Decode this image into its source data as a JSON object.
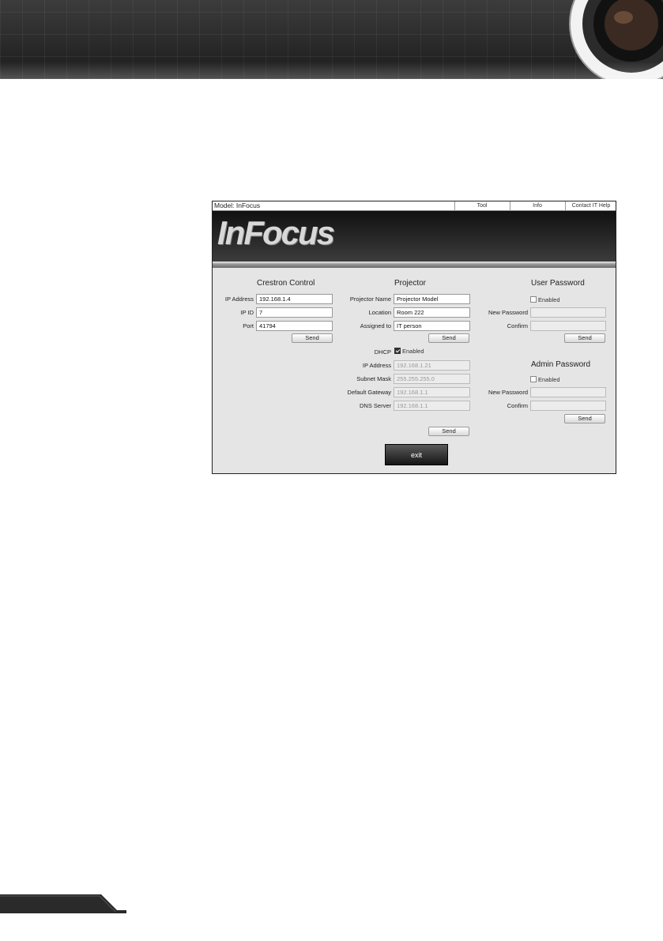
{
  "topbar": {
    "model_label": "Model: InFocus",
    "nav": [
      "Tool",
      "Info",
      "Contact IT Help"
    ]
  },
  "logo": {
    "text": "InFocus"
  },
  "crestron": {
    "title": "Crestron Control",
    "ip_label": "IP Address",
    "ip_value": "192.168.1.4",
    "ipid_label": "IP ID",
    "ipid_value": "7",
    "port_label": "Port",
    "port_value": "41794",
    "send_label": "Send"
  },
  "projector": {
    "title": "Projector",
    "name_label": "Projector Name",
    "name_value": "Projector Model",
    "location_label": "Location",
    "location_value": "Room 222",
    "assigned_label": "Assigned to",
    "assigned_value": "IT person",
    "send_label": "Send",
    "dhcp_label": "DHCP",
    "dhcp_enabled_label": "Enabled",
    "dhcp_checked": true,
    "ip_label": "IP Address",
    "ip_value": "192.168.1.21",
    "subnet_label": "Subnet Mask",
    "subnet_value": "255.255.255.0",
    "gateway_label": "Default Gateway",
    "gateway_value": "192.168.1.1",
    "dns_label": "DNS Server",
    "dns_value": "192.168.1.1",
    "network_send_label": "Send"
  },
  "user_password": {
    "title": "User Password",
    "enabled_label": "Enabled",
    "enabled_checked": false,
    "new_label": "New Password",
    "new_value": "",
    "confirm_label": "Confirm",
    "confirm_value": "",
    "send_label": "Send"
  },
  "admin_password": {
    "title": "Admin Password",
    "enabled_label": "Enabled",
    "enabled_checked": false,
    "new_label": "New Password",
    "new_value": "",
    "confirm_label": "Confirm",
    "confirm_value": "",
    "send_label": "Send"
  },
  "exit_label": "exit",
  "colors": {
    "header_dark": "#2a2a2a",
    "panel_bg": "#e5e5e5",
    "exit_button": "#1a1a1a"
  },
  "icons": {
    "checkbox": "checkbox-icon",
    "lens": "projector-lens-icon"
  }
}
